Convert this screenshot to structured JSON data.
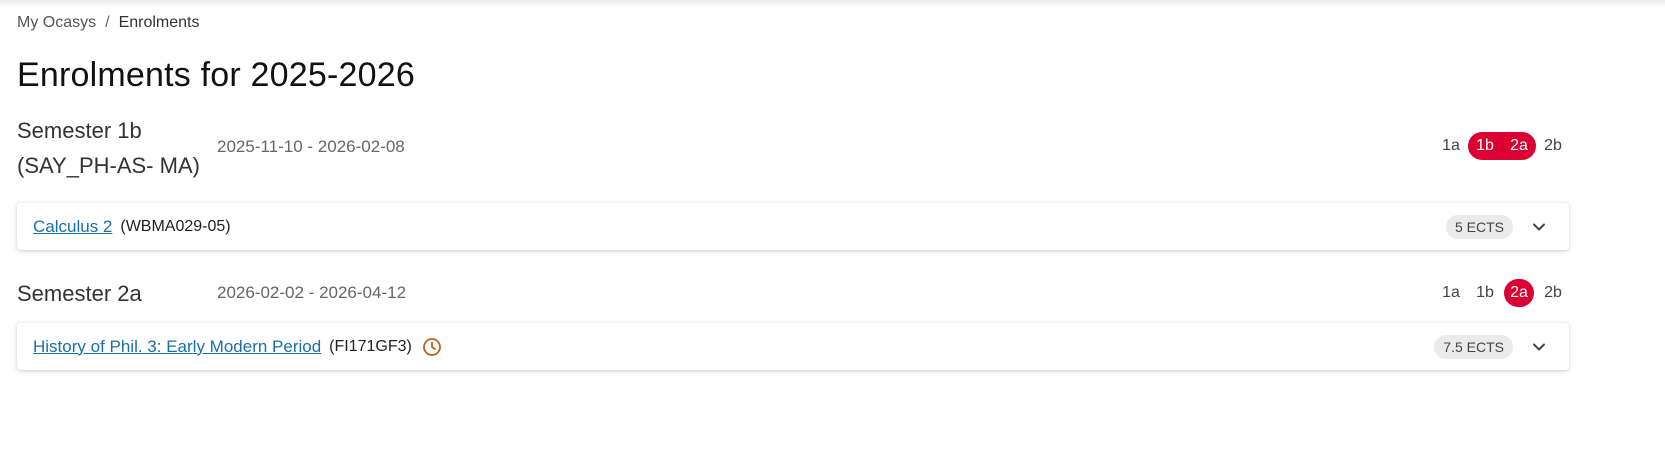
{
  "breadcrumb": {
    "home": "My Ocasys",
    "separator": "/",
    "current": "Enrolments"
  },
  "page_title": "Enrolments for 2025-2026",
  "colors": {
    "accent": "#dc0032",
    "link": "#1a6fa8",
    "clock": "#c0621e"
  },
  "semesters": [
    {
      "name_line1": "Semester 1b",
      "name_line2": "(SAY_PH-AS- MA)",
      "dates": "2025-11-10 - 2026-02-08",
      "periods": [
        "1a",
        "1b",
        "2a",
        "2b"
      ],
      "active_periods": [
        "1b",
        "2a"
      ],
      "courses": [
        {
          "title": "Calculus 2",
          "code": "(WBMA029-05)",
          "ects": "5 ECTS",
          "icon": ""
        }
      ]
    },
    {
      "name_line1": "Semester 2a",
      "dates": "2026-02-02 - 2026-04-12",
      "periods": [
        "1a",
        "1b",
        "2a",
        "2b"
      ],
      "active_periods": [
        "2a"
      ],
      "courses": [
        {
          "title": "History of Phil. 3: Early Modern Period",
          "code": "(FI171GF3)",
          "ects": "7.5 ECTS",
          "icon": "clock-icon"
        }
      ]
    }
  ]
}
